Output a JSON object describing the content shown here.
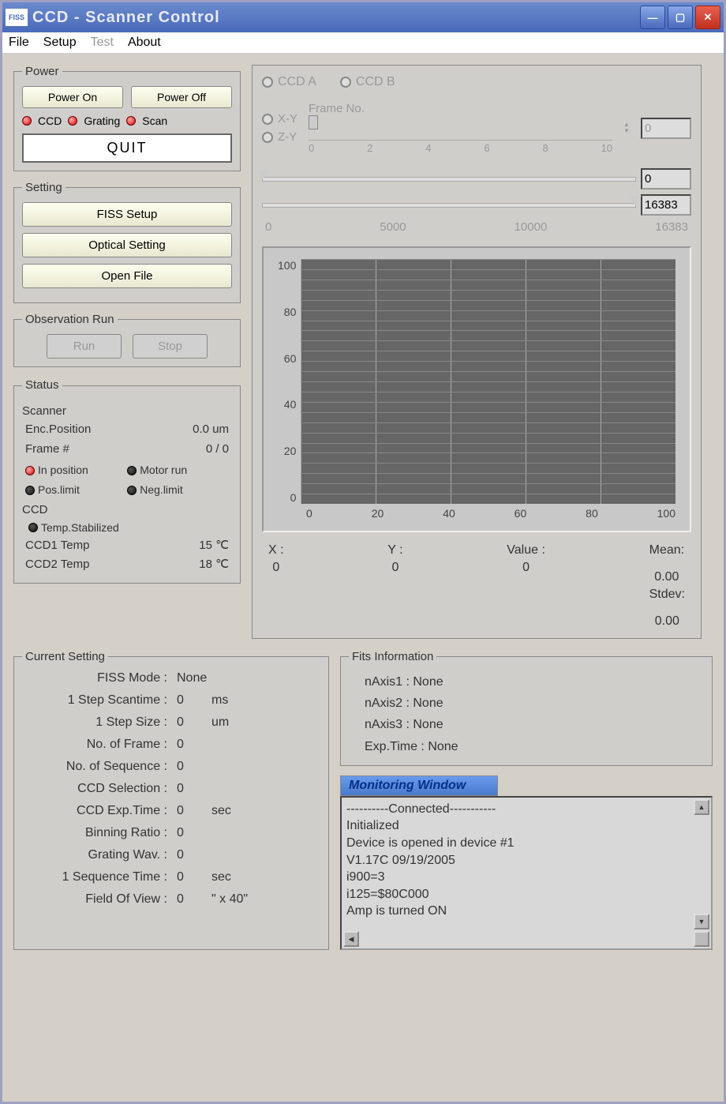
{
  "window": {
    "icon_text": "FISS",
    "title": "CCD - Scanner Control"
  },
  "menu": {
    "file": "File",
    "setup": "Setup",
    "test": "Test",
    "about": "About"
  },
  "power": {
    "legend": "Power",
    "on": "Power On",
    "off": "Power Off",
    "ccd": "CCD",
    "grating": "Grating",
    "scan": "Scan",
    "quit": "QUIT"
  },
  "setting": {
    "legend": "Setting",
    "fiss": "FISS Setup",
    "optical": "Optical Setting",
    "open": "Open File"
  },
  "obs": {
    "legend": "Observation Run",
    "run": "Run",
    "stop": "Stop"
  },
  "status": {
    "legend": "Status",
    "scanner": "Scanner",
    "enc_label": "Enc.Position",
    "enc_val": "0.0 um",
    "frame_label": "Frame #",
    "frame_val": "0 / 0",
    "in_pos": "In position",
    "motor": "Motor run",
    "pos": "Pos.limit",
    "neg": "Neg.limit",
    "ccd": "CCD",
    "temp_stab": "Temp.Stabilized",
    "ccd1_label": "CCD1 Temp",
    "ccd1_val": "15 ℃",
    "ccd2_label": "CCD2 Temp",
    "ccd2_val": "18 ℃"
  },
  "display": {
    "ccd_a": "CCD A",
    "ccd_b": "CCD B",
    "xy": "X-Y",
    "zy": "Z-Y",
    "frame_no": "Frame No.",
    "frame_ticks": [
      "0",
      "2",
      "4",
      "6",
      "8",
      "10"
    ],
    "frame_val": "0",
    "range_lo": "0",
    "range_hi": "16383",
    "range_ticks": [
      "0",
      "5000",
      "10000",
      "16383"
    ],
    "stats": {
      "x_label": "X :",
      "x_val": "0",
      "y_label": "Y :",
      "y_val": "0",
      "value_label": "Value :",
      "value_val": "0",
      "mean_label": "Mean:",
      "mean_val": "0.00",
      "stdev_label": "Stdev:",
      "stdev_val": "0.00"
    }
  },
  "chart_data": {
    "type": "heatmap",
    "title": "",
    "xlabel": "",
    "ylabel": "",
    "xlim": [
      0,
      100
    ],
    "ylim": [
      0,
      100
    ],
    "x_ticks": [
      0,
      20,
      40,
      60,
      80,
      100
    ],
    "y_ticks": [
      0,
      20,
      40,
      60,
      80,
      100
    ],
    "series": []
  },
  "current": {
    "legend": "Current Setting",
    "rows": [
      {
        "label": "FISS Mode :",
        "val": "None",
        "unit": ""
      },
      {
        "label": "1 Step Scantime :",
        "val": "0",
        "unit": "ms"
      },
      {
        "label": "1 Step Size :",
        "val": "0",
        "unit": "um"
      },
      {
        "label": "No. of Frame :",
        "val": "0",
        "unit": ""
      },
      {
        "label": "No. of Sequence :",
        "val": "0",
        "unit": ""
      },
      {
        "label": "CCD Selection :",
        "val": "0",
        "unit": ""
      },
      {
        "label": "CCD Exp.Time :",
        "val": "0",
        "unit": "sec"
      },
      {
        "label": "Binning  Ratio :",
        "val": "0",
        "unit": ""
      },
      {
        "label": "Grating Wav. :",
        "val": "0",
        "unit": ""
      },
      {
        "label": "1 Sequence Time :",
        "val": "0",
        "unit": "sec"
      },
      {
        "label": "Field Of View :",
        "val": "0",
        "unit": "\" x 40\""
      }
    ]
  },
  "fits": {
    "legend": "Fits Information",
    "n1": "nAxis1 :  None",
    "n2": "nAxis2 :  None",
    "n3": "nAxis3 :  None",
    "exp": "Exp.Time :  None"
  },
  "monitor": {
    "title": "Monitoring Window",
    "l1": "----------Connected-----------",
    "l2": "Initialized",
    "l3": "Device is opened in device #1",
    "l4": "V1.17C  09/19/2005",
    "l5": "i900=3",
    "l6": "i125=$80C000",
    "l7": "Amp is turned ON"
  }
}
